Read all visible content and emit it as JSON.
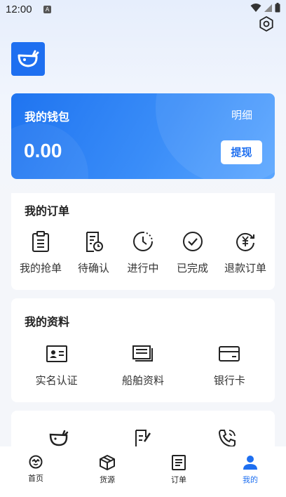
{
  "status": {
    "time": "12:00",
    "badge": "A"
  },
  "wallet": {
    "title": "我的钱包",
    "detail": "明细",
    "amount": "0.00",
    "withdraw": "提现"
  },
  "orders": {
    "title": "我的订单",
    "items": [
      {
        "label": "我的抢单",
        "icon": "clipboard-icon"
      },
      {
        "label": "待确认",
        "icon": "document-clock-icon"
      },
      {
        "label": "进行中",
        "icon": "clock-icon"
      },
      {
        "label": "已完成",
        "icon": "check-circle-icon"
      },
      {
        "label": "退款订单",
        "icon": "refund-icon"
      }
    ]
  },
  "profile": {
    "title": "我的资料",
    "items": [
      {
        "label": "实名认证",
        "icon": "id-card-icon"
      },
      {
        "label": "船舶资料",
        "icon": "book-icon"
      },
      {
        "label": "银行卡",
        "icon": "bank-card-icon"
      }
    ]
  },
  "tabbar": {
    "items": [
      {
        "label": "首页",
        "icon": "home-icon"
      },
      {
        "label": "货源",
        "icon": "box-icon"
      },
      {
        "label": "订单",
        "icon": "order-icon"
      },
      {
        "label": "我的",
        "icon": "user-icon",
        "active": true
      }
    ]
  },
  "colors": {
    "accent": "#1e6ff0",
    "background": "#f4f6fa"
  }
}
